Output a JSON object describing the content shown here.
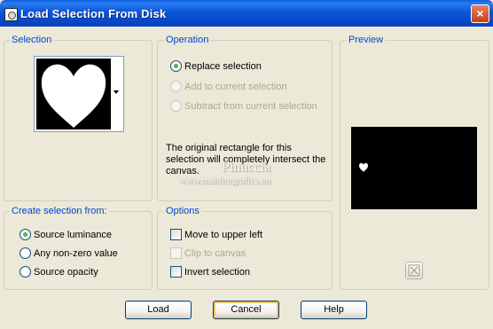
{
  "window": {
    "title": "Load Selection From Disk",
    "close_glyph": "×"
  },
  "selection": {
    "legend": "Selection"
  },
  "operation": {
    "legend": "Operation",
    "options": [
      {
        "label": "Replace selection",
        "checked": true,
        "enabled": true
      },
      {
        "label": "Add to current selection",
        "checked": false,
        "enabled": false
      },
      {
        "label": "Subtract from current selection",
        "checked": false,
        "enabled": false
      }
    ],
    "message": "The original rectangle for this selection will completely intersect the canvas."
  },
  "watermark": {
    "name": "Pinuccia",
    "url": "www.maidiregrafica.eu"
  },
  "preview": {
    "legend": "Preview"
  },
  "create_from": {
    "legend": "Create selection from:",
    "options": [
      {
        "label": "Source luminance",
        "checked": true
      },
      {
        "label": "Any non-zero value",
        "checked": false
      },
      {
        "label": "Source opacity",
        "checked": false
      }
    ]
  },
  "options": {
    "legend": "Options",
    "items": [
      {
        "label": "Move to upper left",
        "checked": false,
        "enabled": true
      },
      {
        "label": "Clip to canvas",
        "checked": false,
        "enabled": false
      },
      {
        "label": "Invert selection",
        "checked": false,
        "enabled": true
      }
    ]
  },
  "buttons": {
    "load": "Load",
    "cancel": "Cancel",
    "help": "Help"
  },
  "colors": {
    "accent": "#0046d5",
    "titlebar": "#0b57d8",
    "dialog_bg": "#ece9d8"
  },
  "icons": [
    "app-icon",
    "close-icon",
    "dropdown-arrow-icon",
    "heart-selection-thumbnail",
    "heart-preview-icon",
    "zoom-preview-icon"
  ]
}
